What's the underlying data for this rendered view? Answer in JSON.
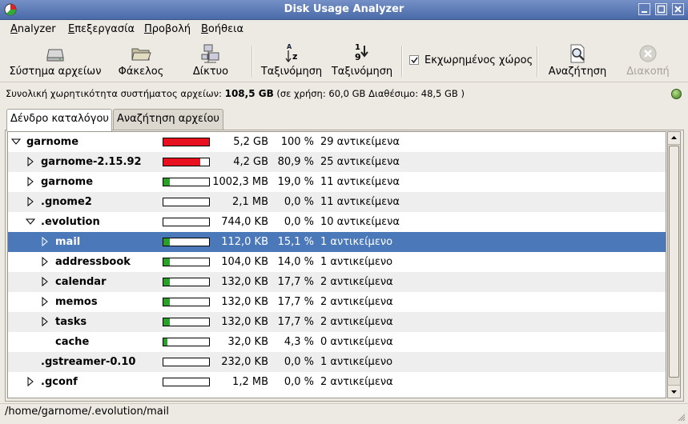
{
  "window": {
    "title": "Disk Usage Analyzer"
  },
  "menubar": {
    "items": [
      {
        "mnemonic": "A",
        "rest": "nalyzer"
      },
      {
        "mnemonic": "Ε",
        "rest": "πεξεργασία"
      },
      {
        "mnemonic": "Π",
        "rest": "ροβολή"
      },
      {
        "mnemonic": "Β",
        "rest": "οήθεια"
      }
    ]
  },
  "toolbar": {
    "filesystem": "Σύστημα αρχείων",
    "folder": "Φάκελος",
    "network": "Δίκτυο",
    "sort_name": "Ταξινόμηση",
    "sort_size": "Ταξινόμηση",
    "sort_name_glyph_top": "A",
    "sort_name_glyph_bottom": "z",
    "sort_size_glyph_top": "1",
    "sort_size_glyph_bottom": "9",
    "allocated_space": "Εκχωρημένος χώρος",
    "allocated_checked": true,
    "search": "Αναζήτηση",
    "stop": "Διακοπή"
  },
  "fs_info": {
    "prefix": "Συνολική χωρητικότητα συστήματος αρχείων:",
    "total": "108,5 GB",
    "detail": "(σε χρήση: 60,0 GB Διαθέσιμο: 48,5 GB )"
  },
  "tabs": [
    "Δένδρο καταλόγου",
    "Αναζήτηση αρχείου"
  ],
  "rows": [
    {
      "name": "garnome",
      "depth": 0,
      "expander": "open",
      "fill": 1.0,
      "fill_color": "#e8101e",
      "size": "5,2 GB",
      "percent": "100 %",
      "items": "29 αντικείμενα",
      "selected": false
    },
    {
      "name": "garnome-2.15.92",
      "depth": 1,
      "expander": "closed",
      "fill": 0.809,
      "fill_color": "#e8101e",
      "size": "4,2 GB",
      "percent": "80,9 %",
      "items": "25 αντικείμενα",
      "selected": false
    },
    {
      "name": "garnome",
      "depth": 1,
      "expander": "closed",
      "fill": 0.19,
      "fill_color": "#2aa02a",
      "size": "1002,3 MB",
      "percent": "19,0 %",
      "items": "11 αντικείμενα",
      "selected": false
    },
    {
      "name": ".gnome2",
      "depth": 1,
      "expander": "closed",
      "fill": 0.0,
      "fill_color": "#2aa02a",
      "size": "2,1 MB",
      "percent": "0,0 %",
      "items": "11 αντικείμενα",
      "selected": false
    },
    {
      "name": ".evolution",
      "depth": 1,
      "expander": "open",
      "fill": 0.0,
      "fill_color": "#2aa02a",
      "size": "744,0 KB",
      "percent": "0,0 %",
      "items": "10 αντικείμενα",
      "selected": false
    },
    {
      "name": "mail",
      "depth": 2,
      "expander": "closed",
      "fill": 0.151,
      "fill_color": "#2aa02a",
      "size": "112,0 KB",
      "percent": "15,1 %",
      "items": "1 αντικείμενο",
      "selected": true
    },
    {
      "name": "addressbook",
      "depth": 2,
      "expander": "closed",
      "fill": 0.14,
      "fill_color": "#2aa02a",
      "size": "104,0 KB",
      "percent": "14,0 %",
      "items": "1 αντικείμενο",
      "selected": false
    },
    {
      "name": "calendar",
      "depth": 2,
      "expander": "closed",
      "fill": 0.177,
      "fill_color": "#2aa02a",
      "size": "132,0 KB",
      "percent": "17,7 %",
      "items": "2 αντικείμενα",
      "selected": false
    },
    {
      "name": "memos",
      "depth": 2,
      "expander": "closed",
      "fill": 0.177,
      "fill_color": "#2aa02a",
      "size": "132,0 KB",
      "percent": "17,7 %",
      "items": "2 αντικείμενα",
      "selected": false
    },
    {
      "name": "tasks",
      "depth": 2,
      "expander": "closed",
      "fill": 0.177,
      "fill_color": "#2aa02a",
      "size": "132,0 KB",
      "percent": "17,7 %",
      "items": "2 αντικείμενα",
      "selected": false
    },
    {
      "name": "cache",
      "depth": 2,
      "expander": "none",
      "fill": 0.043,
      "fill_color": "#2aa02a",
      "size": "32,0 KB",
      "percent": "4,3 %",
      "items": "0 αντικείμενα",
      "selected": false
    },
    {
      "name": ".gstreamer-0.10",
      "depth": 1,
      "expander": "none",
      "fill": 0.0,
      "fill_color": "#2aa02a",
      "size": "232,0 KB",
      "percent": "0,0 %",
      "items": "1 αντικείμενο",
      "selected": false
    },
    {
      "name": ".gconf",
      "depth": 1,
      "expander": "closed",
      "fill": 0.0,
      "fill_color": "#2aa02a",
      "size": "1,2 MB",
      "percent": "0,0 %",
      "items": "2 αντικείμενα",
      "selected": false
    }
  ],
  "statusbar": {
    "path": "/home/garnome/.evolution/mail"
  }
}
